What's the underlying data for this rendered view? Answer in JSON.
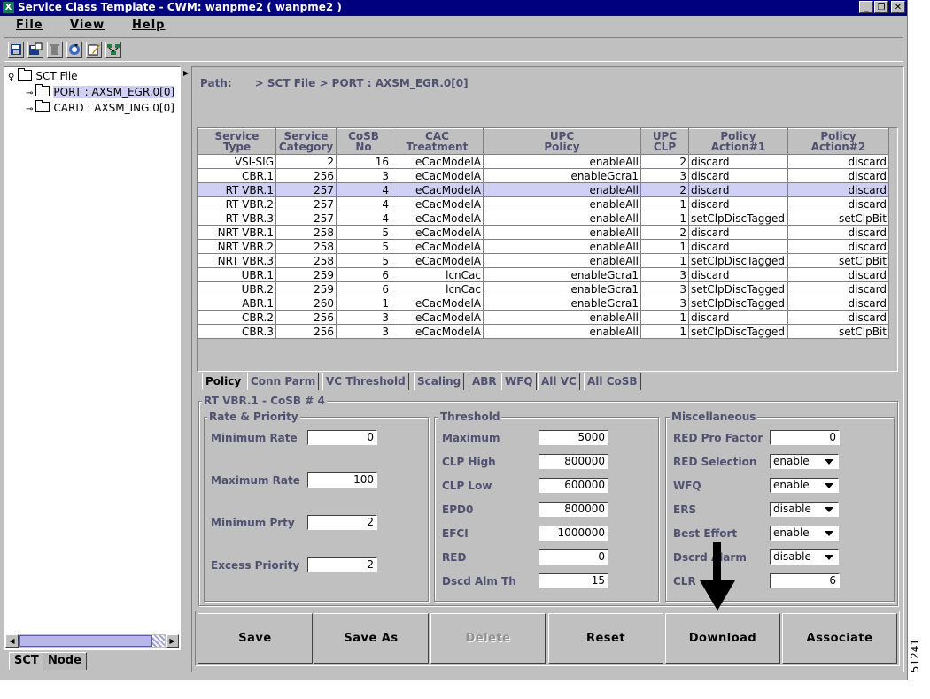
{
  "window": {
    "title": "Service Class Template - CWM: wanpme2 ( wanpme2 )",
    "app_icon": "X",
    "controls": [
      "_",
      "❐",
      "✕"
    ]
  },
  "menu": [
    "File",
    "View",
    "Help"
  ],
  "toolbar_icons": [
    "save-icon",
    "save-as-icon",
    "trash-icon",
    "refresh-icon",
    "edit-icon",
    "network-icon"
  ],
  "tree": {
    "root": "SCT File",
    "children": [
      "PORT : AXSM_EGR.0[0]",
      "CARD : AXSM_ING.0[0]"
    ]
  },
  "left_tabs": [
    "SCT",
    "Node"
  ],
  "path": {
    "label": "Path:",
    "value": "> SCT File > PORT : AXSM_EGR.0[0]"
  },
  "table": {
    "headers": [
      [
        "Service",
        "Type"
      ],
      [
        "Service",
        "Category"
      ],
      [
        "CoSB",
        "No"
      ],
      [
        "CAC",
        "Treatment"
      ],
      [
        "UPC",
        "Policy"
      ],
      [
        "UPC",
        "CLP"
      ],
      [
        "Policy",
        "Action#1"
      ],
      [
        "Policy",
        "Action#2"
      ]
    ],
    "selected_row": 2,
    "rows": [
      [
        "VSI-SIG",
        "2",
        "16",
        "eCacModelA",
        "enableAll",
        "2",
        "discard",
        "discard"
      ],
      [
        "CBR.1",
        "256",
        "3",
        "eCacModelA",
        "enableGcra1",
        "3",
        "discard",
        "discard"
      ],
      [
        "RT VBR.1",
        "257",
        "4",
        "eCacModelA",
        "enableAll",
        "2",
        "discard",
        "discard"
      ],
      [
        "RT VBR.2",
        "257",
        "4",
        "eCacModelA",
        "enableAll",
        "1",
        "discard",
        "discard"
      ],
      [
        "RT VBR.3",
        "257",
        "4",
        "eCacModelA",
        "enableAll",
        "1",
        "setClpDiscTagged",
        "setClpBit"
      ],
      [
        "NRT VBR.1",
        "258",
        "5",
        "eCacModelA",
        "enableAll",
        "2",
        "discard",
        "discard"
      ],
      [
        "NRT VBR.2",
        "258",
        "5",
        "eCacModelA",
        "enableAll",
        "1",
        "discard",
        "discard"
      ],
      [
        "NRT VBR.3",
        "258",
        "5",
        "eCacModelA",
        "enableAll",
        "1",
        "setClpDiscTagged",
        "setClpBit"
      ],
      [
        "UBR.1",
        "259",
        "6",
        "lcnCac",
        "enableGcra1",
        "3",
        "discard",
        "discard"
      ],
      [
        "UBR.2",
        "259",
        "6",
        "lcnCac",
        "enableGcra1",
        "3",
        "setClpDiscTagged",
        "discard"
      ],
      [
        "ABR.1",
        "260",
        "1",
        "eCacModelA",
        "enableGcra1",
        "3",
        "setClpDiscTagged",
        "discard"
      ],
      [
        "CBR.2",
        "256",
        "3",
        "eCacModelA",
        "enableAll",
        "1",
        "discard",
        "discard"
      ],
      [
        "CBR.3",
        "256",
        "3",
        "eCacModelA",
        "enableAll",
        "1",
        "setClpDiscTagged",
        "setClpBit"
      ]
    ]
  },
  "tabs": [
    "Policy",
    "Conn Parm",
    "VC Threshold",
    "Scaling",
    "ABR",
    "WFQ",
    "All VC",
    "All CoSB"
  ],
  "active_tab": "Policy",
  "panel_title": "RT VBR.1 - CoSB # 4",
  "rate_priority": {
    "title": "Rate & Priority",
    "fields": [
      {
        "label": "Minimum Rate",
        "value": "0"
      },
      {
        "label": "Maximum Rate",
        "value": "100"
      },
      {
        "label": "Minimum Prty",
        "value": "2"
      },
      {
        "label": "Excess Priority",
        "value": "2"
      }
    ]
  },
  "threshold": {
    "title": "Threshold",
    "fields": [
      {
        "label": "Maximum",
        "value": "5000"
      },
      {
        "label": "CLP High",
        "value": "800000"
      },
      {
        "label": "CLP Low",
        "value": "600000"
      },
      {
        "label": "EPD0",
        "value": "800000"
      },
      {
        "label": "EFCI",
        "value": "1000000"
      },
      {
        "label": "RED",
        "value": "0"
      },
      {
        "label": "Dscd Alm Th",
        "value": "15"
      }
    ]
  },
  "misc": {
    "title": "Miscellaneous",
    "fields": [
      {
        "label": "RED Pro Factor",
        "value": "0",
        "type": "text"
      },
      {
        "label": "RED Selection",
        "value": "enable",
        "type": "select"
      },
      {
        "label": "WFQ",
        "value": "enable",
        "type": "select"
      },
      {
        "label": "ERS",
        "value": "disable",
        "type": "select"
      },
      {
        "label": "Best Effort",
        "value": "enable",
        "type": "select"
      },
      {
        "label": "Dscrd Alarm",
        "value": "disable",
        "type": "select"
      },
      {
        "label": "CLR",
        "value": "6",
        "type": "text"
      }
    ]
  },
  "buttons": {
    "save": "Save",
    "save_as": "Save As",
    "delete": "Delete",
    "reset": "Reset",
    "download": "Download",
    "associate": "Associate"
  },
  "figure_id": "51241"
}
